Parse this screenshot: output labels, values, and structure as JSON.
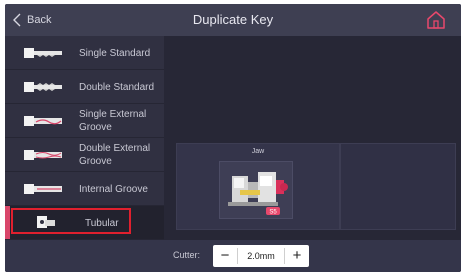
{
  "header": {
    "back_label": "Back",
    "title": "Duplicate Key"
  },
  "sidebar": {
    "items": [
      {
        "label": "Single Standard",
        "icon": "single-standard-key-icon"
      },
      {
        "label": "Double Standard",
        "icon": "double-standard-key-icon"
      },
      {
        "label": "Single External Groove",
        "icon": "single-external-groove-key-icon"
      },
      {
        "label": "Double External Groove",
        "icon": "double-external-groove-key-icon"
      },
      {
        "label": "Internal Groove",
        "icon": "internal-groove-key-icon"
      },
      {
        "label": "Tubular",
        "icon": "tubular-key-icon",
        "selected": true
      }
    ]
  },
  "main": {
    "jaw_label": "Jaw",
    "jaw_badge": "S5"
  },
  "bottom": {
    "cutter_label": "Cutter:",
    "minus_label": "−",
    "cutter_value": "2.0mm",
    "plus_label": "+"
  },
  "colors": {
    "accent": "#d9466a",
    "highlight_border": "#e0202e",
    "header_bg": "#3e3f52",
    "sidebar_bg": "#303041"
  }
}
